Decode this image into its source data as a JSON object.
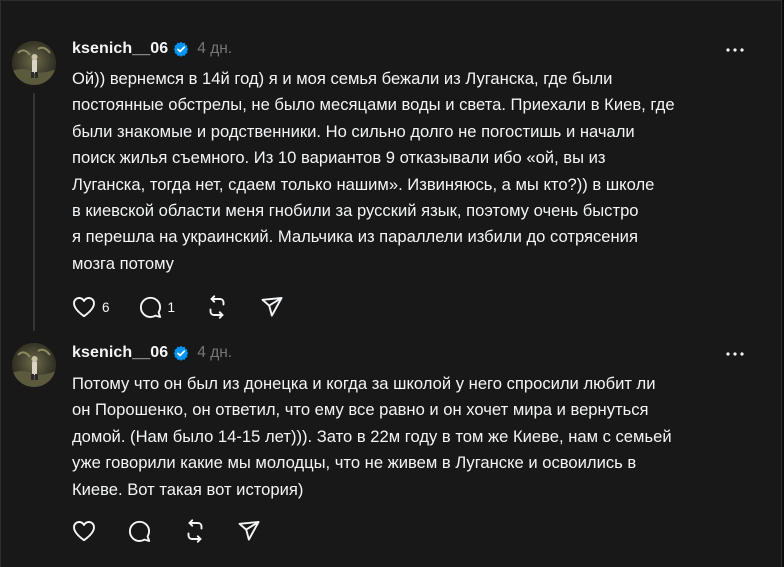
{
  "posts": [
    {
      "username": "ksenich__06",
      "time": "4 дн.",
      "text_lines": [
        "Ой)) вернемся в 14й год) я и моя семья бежали из Луганска, где были",
        "постоянные обстрелы, не было месяцами воды и света. Приехали в Киев, где",
        "были знакомые и родственники. Но сильно долго не погостишь и начали",
        "поиск жилья съемного. Из 10 вариантов 9 отказывали ибо «ой, вы из",
        "Луганска, тогда нет, сдаем только нашим». Извиняюсь, а мы кто?)) в школе",
        "в киевской области меня гнобили за русский язык, поэтому очень быстро",
        "я перешла на украинский. Мальчика из параллели избили до сотрясения",
        "мозга потому"
      ],
      "likes": "6",
      "replies": "1",
      "icons": [
        "heart-icon",
        "comment-icon",
        "repost-icon",
        "share-icon"
      ]
    },
    {
      "username": "ksenich__06",
      "time": "4 дн.",
      "text_lines": [
        "Потому что он был из донецка и когда за школой у него спросили любит ли",
        "он Порошенко, он ответил, что ему все равно и он хочет мира и вернуться",
        "домой. (Нам было 14-15 лет))). Зато в 22м году в том же Киеве, нам с семьей",
        "уже говорили какие мы молодцы, что не живем в Луганске и освоились в",
        "Киеве. Вот такая вот история)"
      ],
      "likes": "",
      "replies": "",
      "icons": [
        "heart-icon",
        "comment-icon",
        "repost-icon",
        "share-icon"
      ]
    }
  ],
  "colors": {
    "background": "#181818",
    "text": "#f3f5f7",
    "muted": "#777777",
    "verified": "#0095f6",
    "thread_line": "#333638"
  }
}
